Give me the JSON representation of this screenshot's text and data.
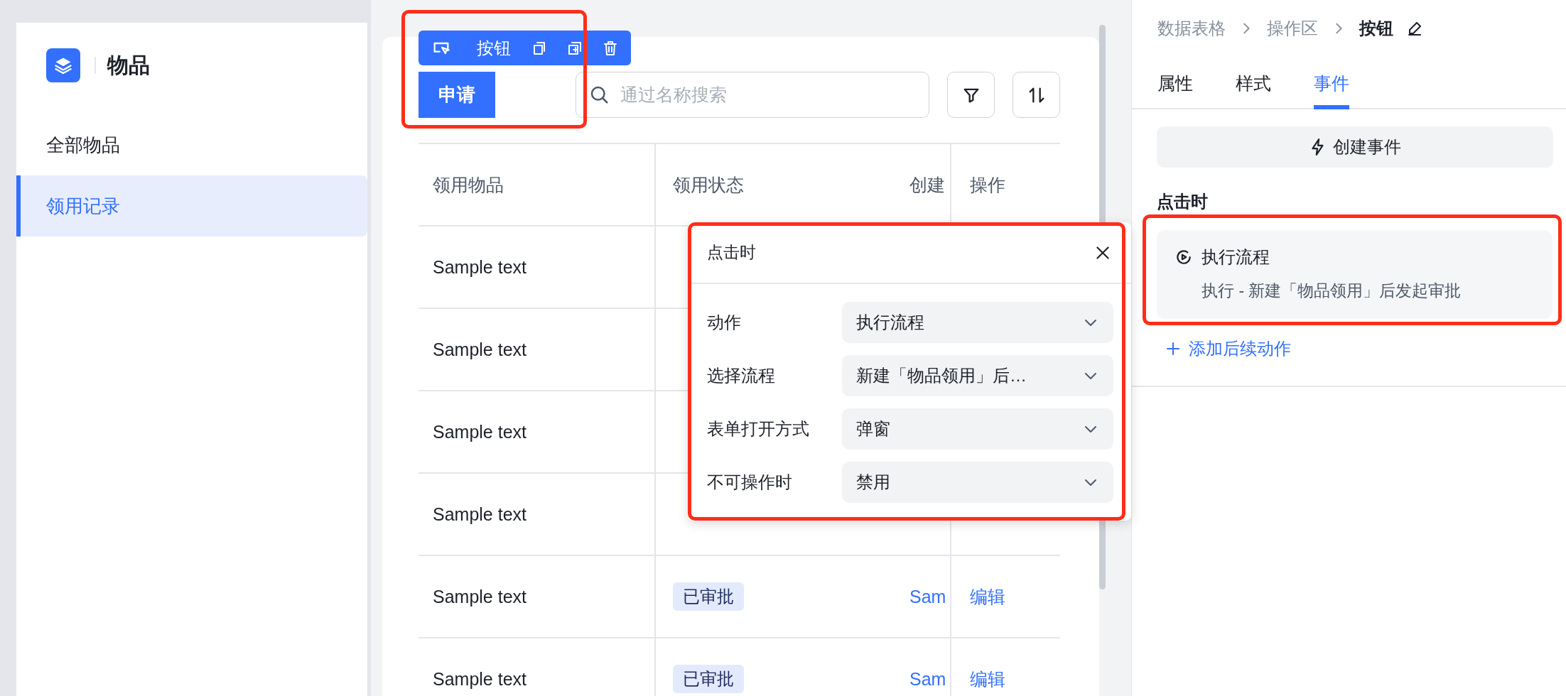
{
  "app": {
    "title": "物品"
  },
  "sidebar": {
    "items": [
      {
        "label": "全部物品",
        "selected": false
      },
      {
        "label": "领用记录",
        "selected": true
      }
    ]
  },
  "component_toolbar": {
    "label": "按钮"
  },
  "toolbar": {
    "primary_button": "申请",
    "search": {
      "placeholder": "通过名称搜索"
    }
  },
  "table": {
    "columns": [
      "领用物品",
      "领用状态",
      "创建",
      "操作"
    ],
    "rows": [
      {
        "item": "Sample text"
      },
      {
        "item": "Sample text"
      },
      {
        "item": "Sample text"
      },
      {
        "item": "Sample text"
      },
      {
        "item": "Sample text",
        "status": "已审批",
        "column_3": "Sam",
        "action": "编辑"
      },
      {
        "item": "Sample text",
        "status": "已审批",
        "column_3": "Sam",
        "action": "编辑"
      }
    ]
  },
  "event_popup": {
    "title": "点击时",
    "fields": [
      {
        "label": "动作",
        "value": "执行流程"
      },
      {
        "label": "选择流程",
        "value": "新建「物品领用」后…"
      },
      {
        "label": "表单打开方式",
        "value": "弹窗"
      },
      {
        "label": "不可操作时",
        "value": "禁用"
      }
    ]
  },
  "inspector": {
    "breadcrumb": [
      {
        "label": "数据表格",
        "current": false
      },
      {
        "label": "操作区",
        "current": false
      },
      {
        "label": "按钮",
        "current": true
      }
    ],
    "tabs": [
      {
        "label": "属性",
        "selected": false
      },
      {
        "label": "样式",
        "selected": false
      },
      {
        "label": "事件",
        "selected": true
      }
    ],
    "create_button": "创建事件",
    "section_title": "点击时",
    "event": {
      "title": "执行流程",
      "description": "执行 - 新建「物品领用」后发起审批"
    },
    "add_link": "添加后续动作"
  }
}
